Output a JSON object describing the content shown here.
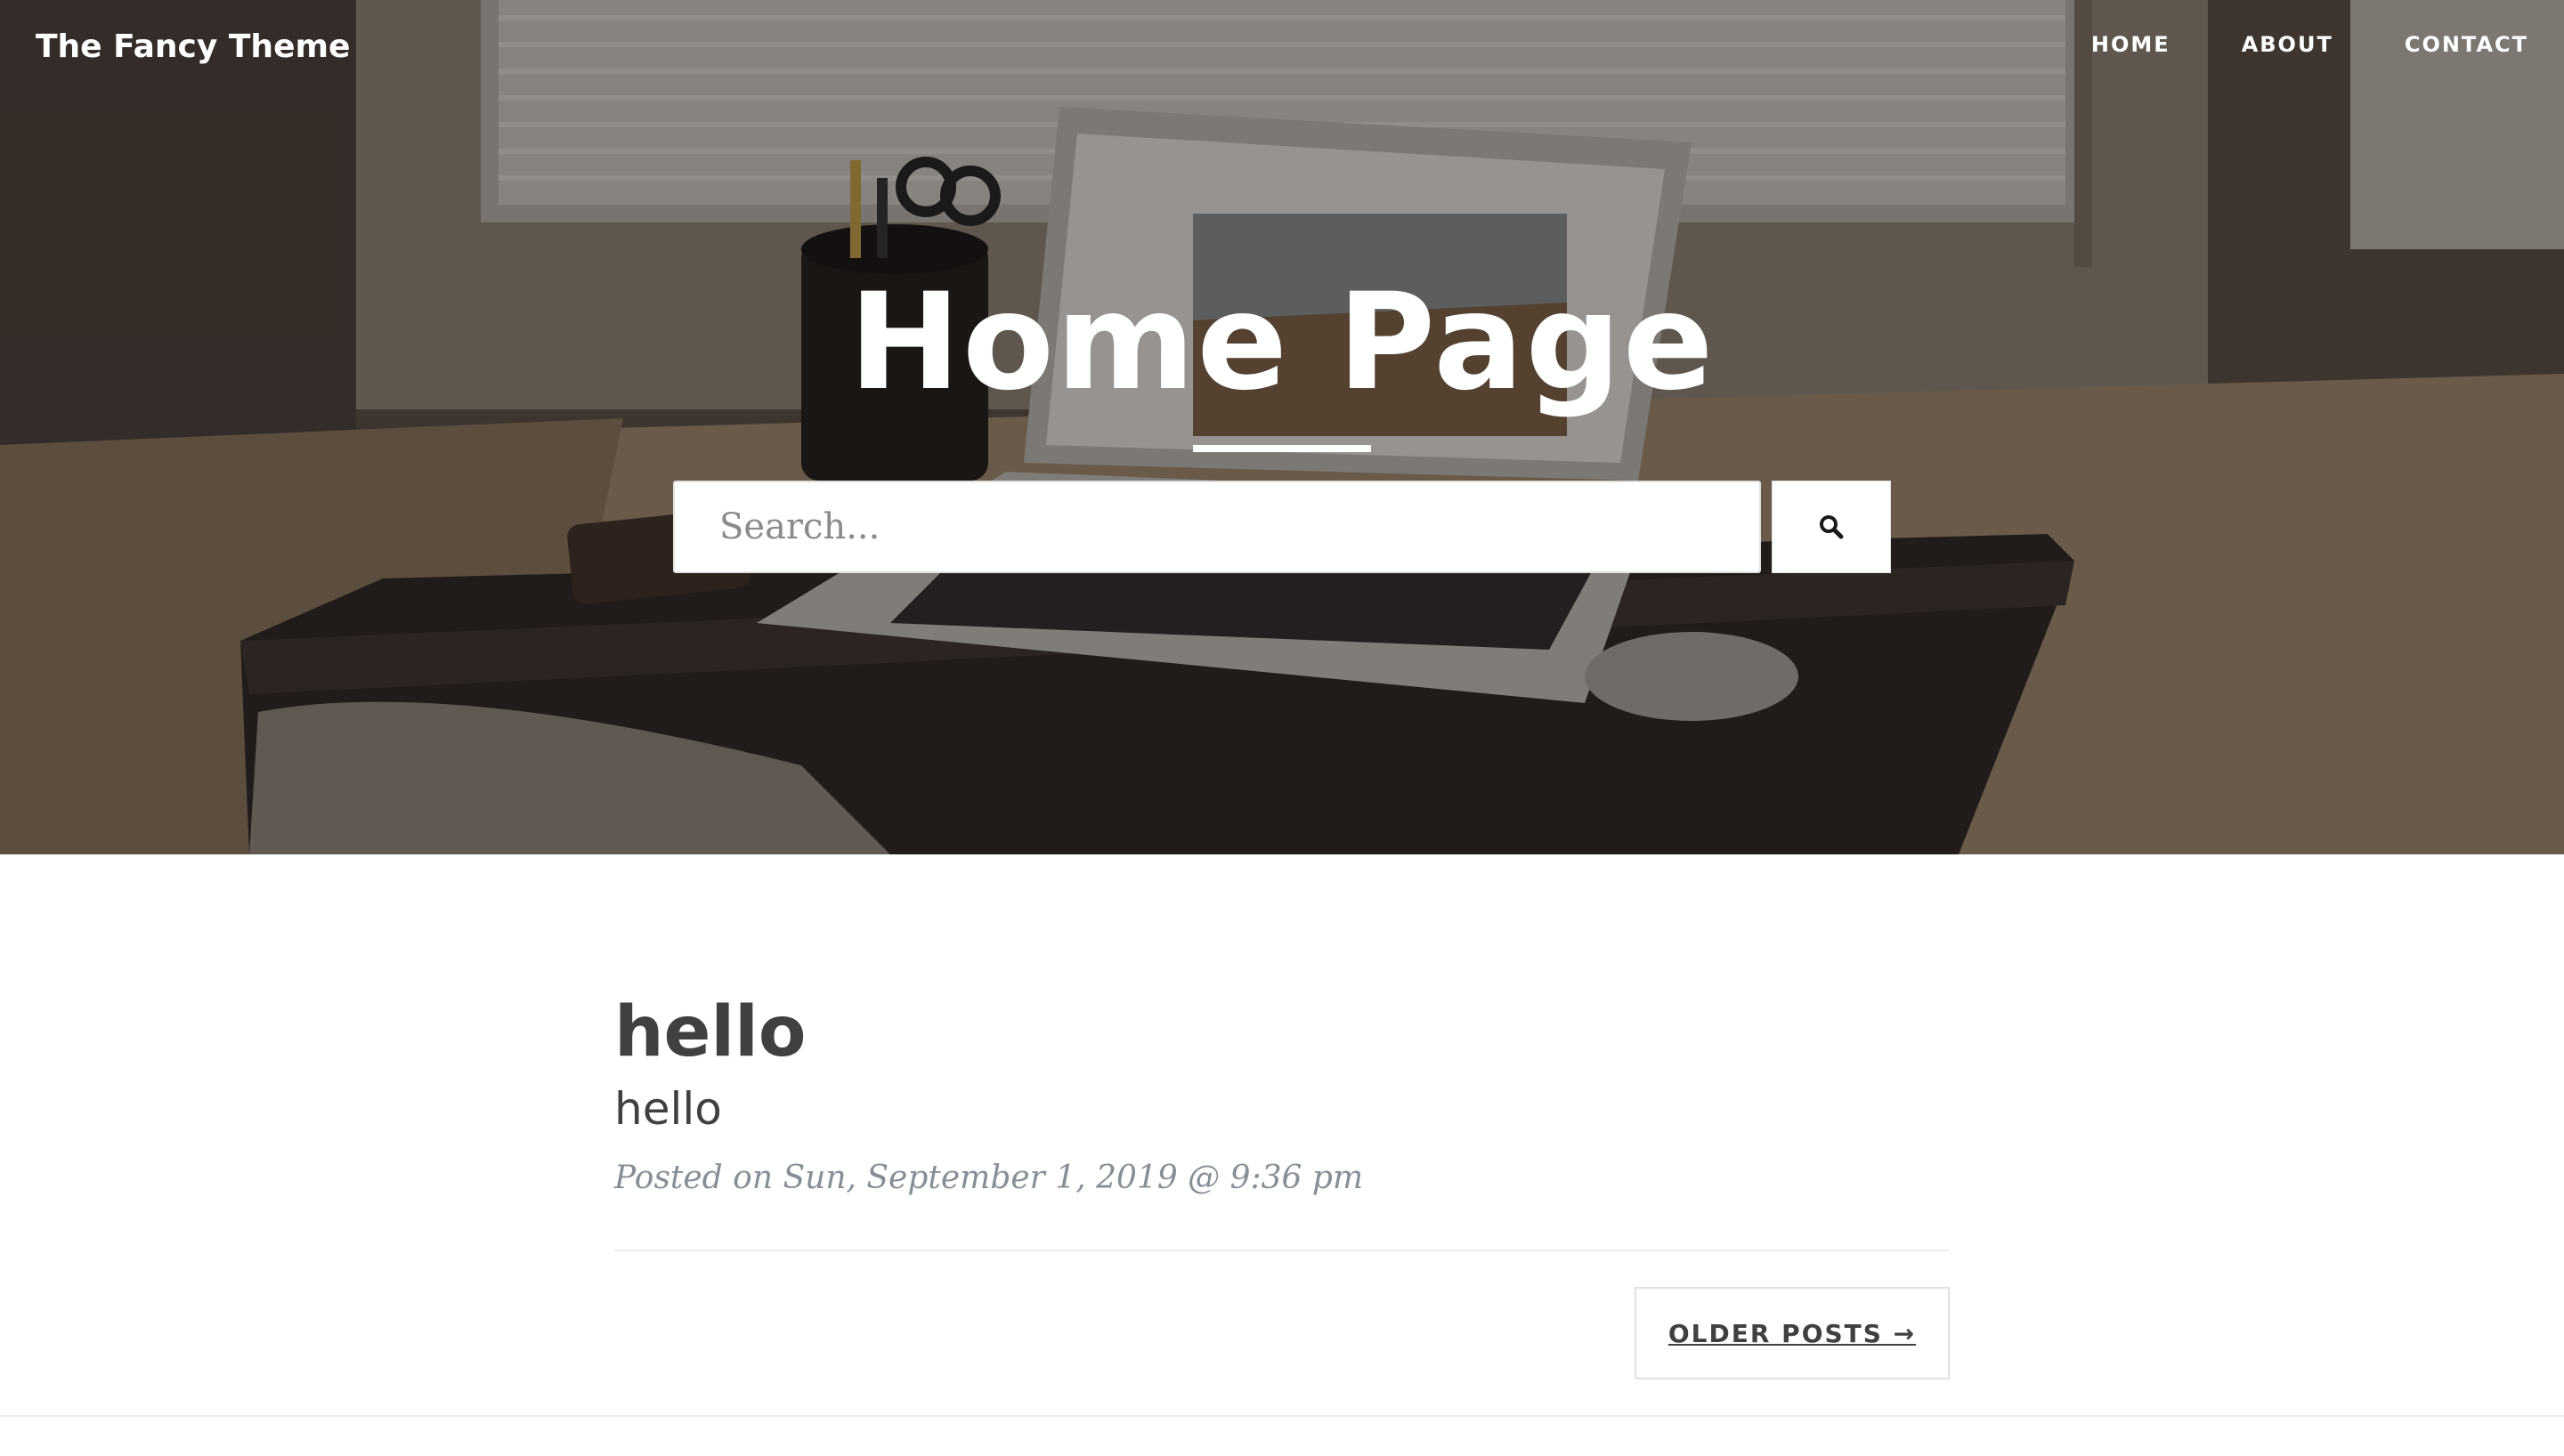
{
  "brand": {
    "label": "The Fancy Theme"
  },
  "nav": {
    "items": [
      {
        "label": "HOME"
      },
      {
        "label": "ABOUT"
      },
      {
        "label": "CONTACT"
      }
    ]
  },
  "hero": {
    "title": "Home Page",
    "background_image": "dark desk with laptop, pen cup with scissors, phone and mouse by a window"
  },
  "search": {
    "placeholder": "Search...",
    "value": "",
    "button_icon": "search-icon"
  },
  "posts": [
    {
      "title": "hello",
      "subtitle": "hello",
      "meta": "Posted on Sun, September 1, 2019 @ 9:36 pm"
    }
  ],
  "pager": {
    "older_label": "OLDER POSTS →"
  },
  "colors": {
    "text": "#404040",
    "meta": "#868e96",
    "hero_text": "#ffffff",
    "divider": "#ececec"
  }
}
